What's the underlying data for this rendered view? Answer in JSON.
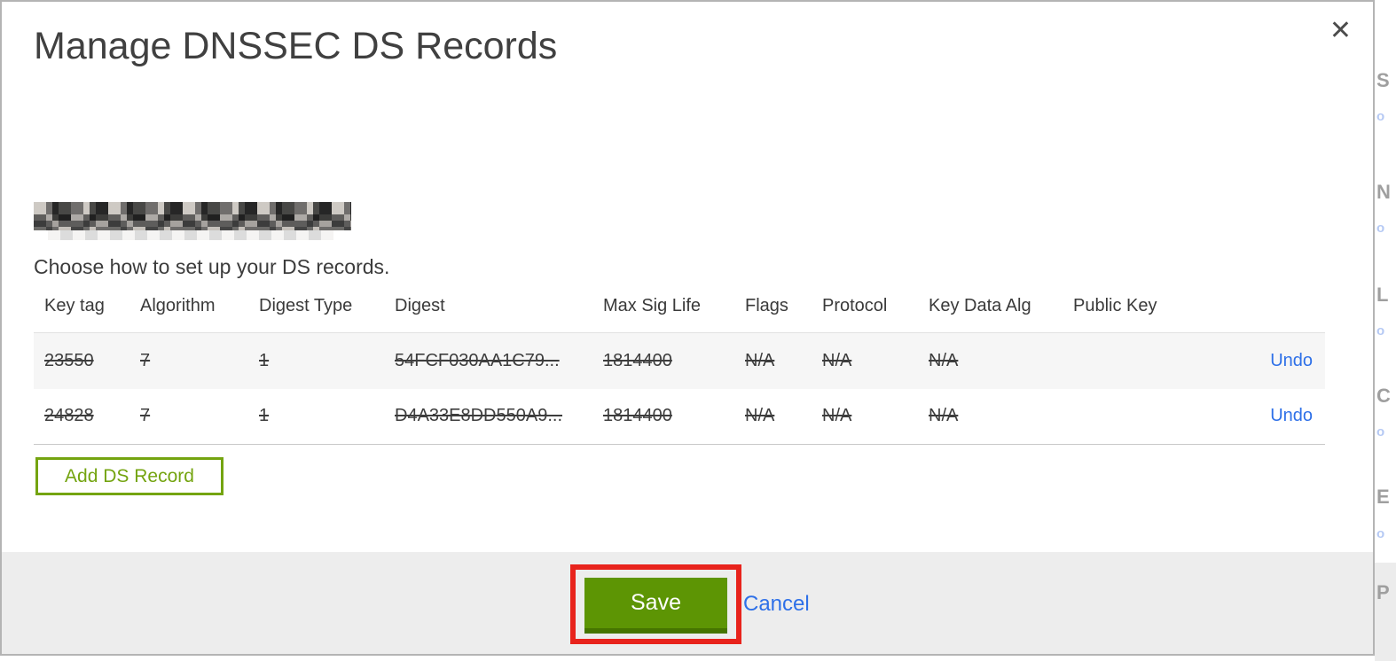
{
  "modal": {
    "title": "Manage DNSSEC DS Records",
    "close_icon": "✕",
    "domain_redacted": true,
    "subtitle": "Choose how to set up your DS records.",
    "table": {
      "headers": [
        "Key tag",
        "Algorithm",
        "Digest Type",
        "Digest",
        "Max Sig Life",
        "Flags",
        "Protocol",
        "Key Data Alg",
        "Public Key"
      ],
      "rows": [
        {
          "key_tag": "23550",
          "algorithm": "7",
          "digest_type": "1",
          "digest": "54FCF030AA1C79...",
          "max_sig_life": "1814400",
          "flags": "N/A",
          "protocol": "N/A",
          "key_data_alg": "N/A",
          "public_key": "",
          "action": "Undo",
          "deleted": true
        },
        {
          "key_tag": "24828",
          "algorithm": "7",
          "digest_type": "1",
          "digest": "D4A33E8DD550A9...",
          "max_sig_life": "1814400",
          "flags": "N/A",
          "protocol": "N/A",
          "key_data_alg": "N/A",
          "public_key": "",
          "action": "Undo",
          "deleted": true
        }
      ]
    },
    "add_button_label": "Add DS Record",
    "footer": {
      "save_label": "Save",
      "cancel_label": "Cancel"
    }
  },
  "colors": {
    "accent_green": "#74a410",
    "save_button_green": "#5d9504",
    "link_blue": "#2e70e8",
    "annotation_red": "#e8231c",
    "footer_gray": "#ededed"
  },
  "background_strip": {
    "fragments": [
      {
        "glyph": "S"
      },
      {
        "glyph": "o"
      },
      {
        "glyph": "N"
      },
      {
        "glyph": "o"
      },
      {
        "glyph": "L"
      },
      {
        "glyph": "o"
      },
      {
        "glyph": "C"
      },
      {
        "glyph": "o"
      },
      {
        "glyph": "E"
      },
      {
        "glyph": "o"
      },
      {
        "glyph": "P"
      }
    ]
  }
}
